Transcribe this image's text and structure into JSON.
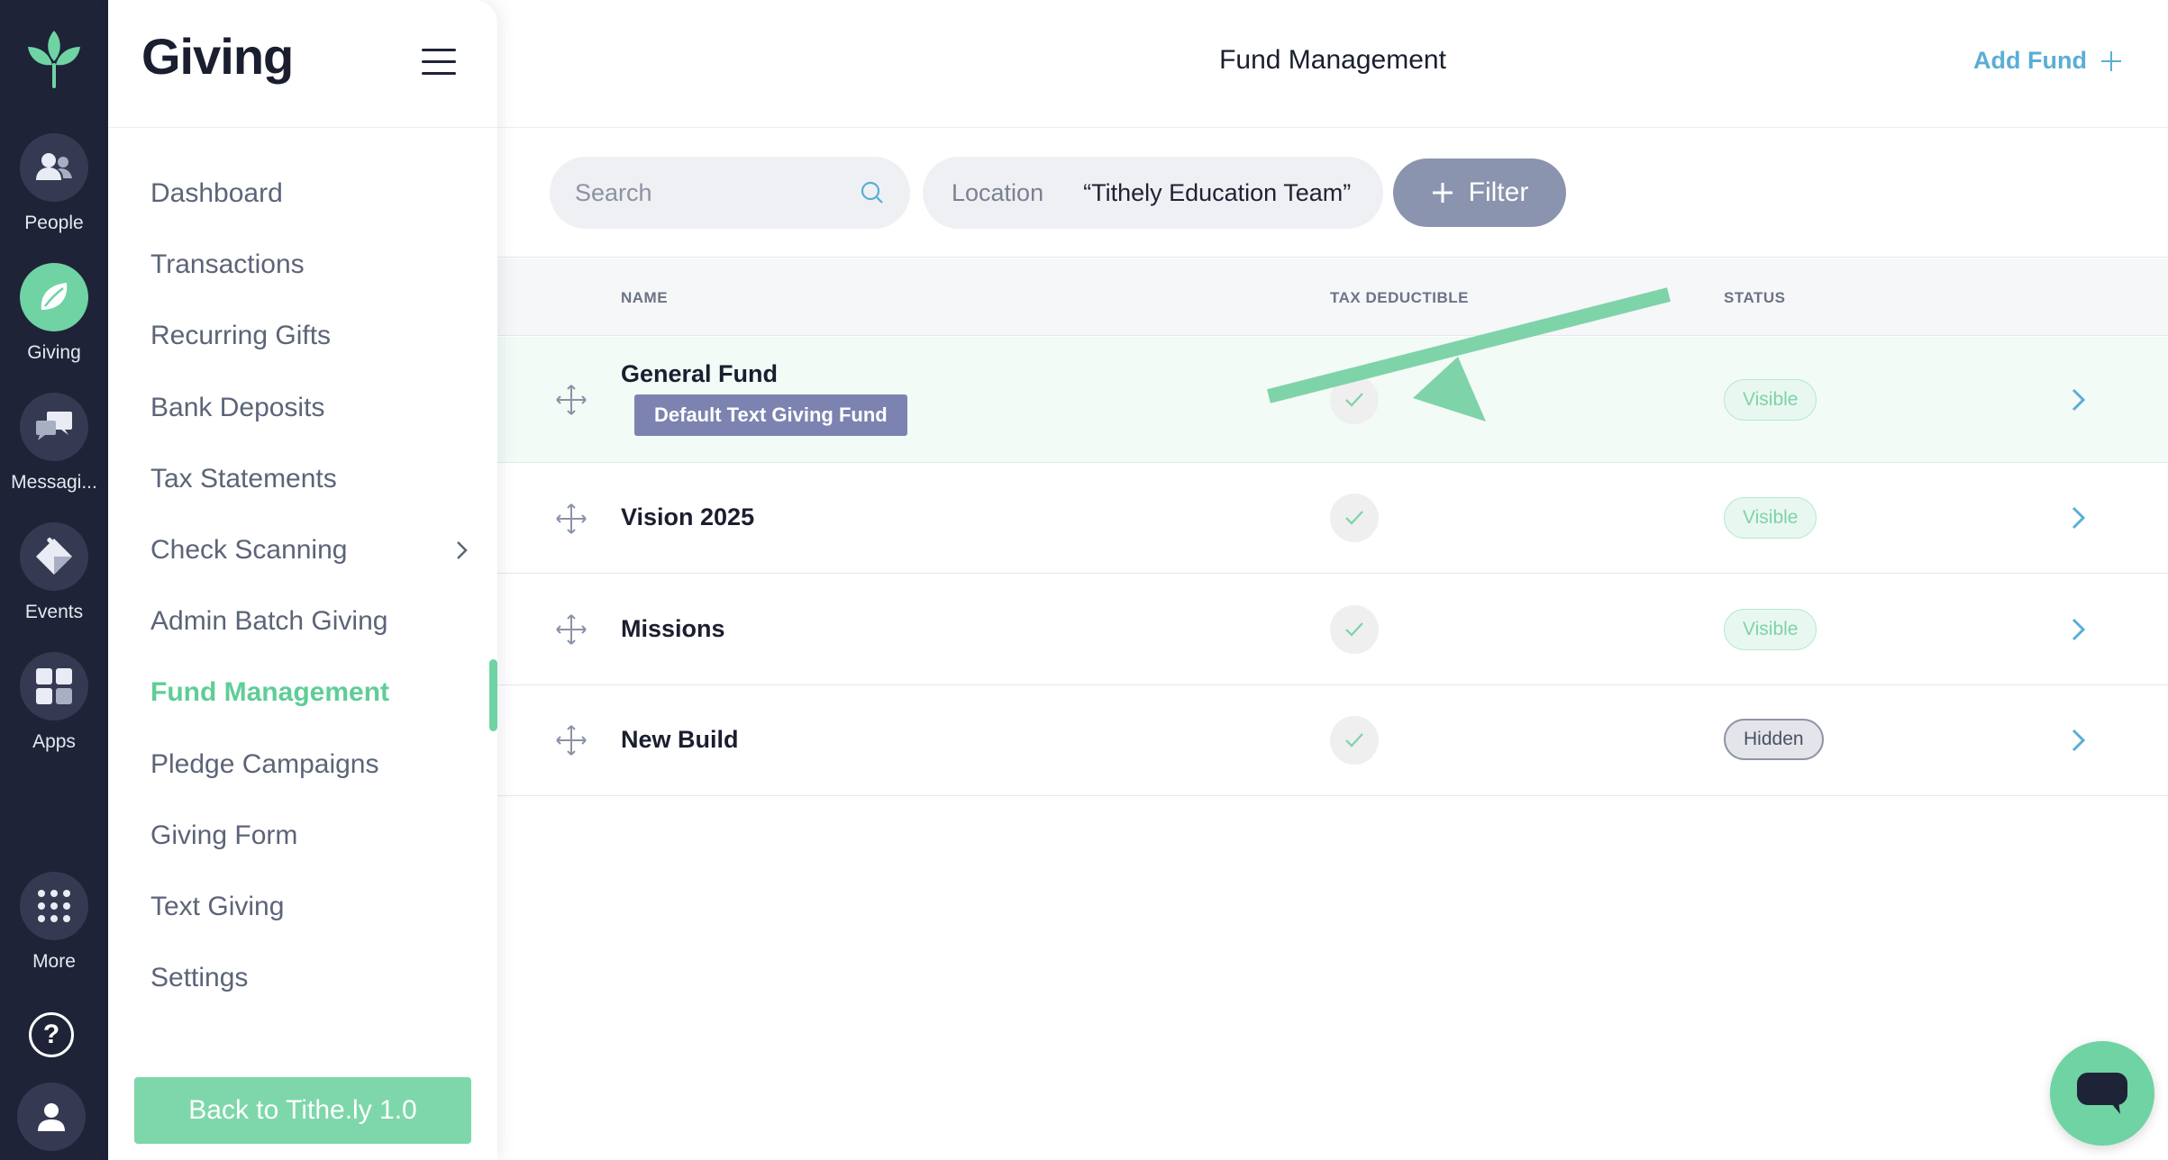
{
  "rail": {
    "items": [
      {
        "label": "People",
        "icon": "people-icon"
      },
      {
        "label": "Giving",
        "icon": "giving-leaf-icon",
        "active": true
      },
      {
        "label": "Messagi...",
        "icon": "messaging-icon"
      },
      {
        "label": "Events",
        "icon": "events-ticket-icon"
      },
      {
        "label": "Apps",
        "icon": "apps-grid-icon"
      },
      {
        "label": "More",
        "icon": "more-dots-icon"
      }
    ],
    "help_glyph": "?"
  },
  "nav": {
    "title": "Giving",
    "items": [
      {
        "label": "Dashboard"
      },
      {
        "label": "Transactions"
      },
      {
        "label": "Recurring Gifts"
      },
      {
        "label": "Bank Deposits"
      },
      {
        "label": "Tax Statements"
      },
      {
        "label": "Check Scanning",
        "has_submenu": true
      },
      {
        "label": "Admin Batch Giving"
      },
      {
        "label": "Fund Management",
        "active": true
      },
      {
        "label": "Pledge Campaigns"
      },
      {
        "label": "Giving Form"
      },
      {
        "label": "Text Giving"
      },
      {
        "label": "Settings"
      }
    ],
    "back_button": "Back to Tithe.ly 1.0"
  },
  "header": {
    "title": "Fund Management",
    "add_fund": "Add Fund"
  },
  "filters": {
    "search_placeholder": "Search",
    "location_label": "Location",
    "location_value": "“Tithely Education Team”",
    "filter_button": "Filter"
  },
  "table": {
    "columns": [
      "NAME",
      "TAX DEDUCTIBLE",
      "STATUS"
    ],
    "rows": [
      {
        "name": "General Fund",
        "badge": "Default Text Giving Fund",
        "tax_deductible": true,
        "status": "Visible"
      },
      {
        "name": "Vision 2025",
        "tax_deductible": true,
        "status": "Visible"
      },
      {
        "name": "Missions",
        "tax_deductible": true,
        "status": "Visible"
      },
      {
        "name": "New Build",
        "tax_deductible": true,
        "status": "Hidden"
      }
    ]
  },
  "colors": {
    "rail_bg": "#1f2337",
    "accent_green": "#6fd3a3",
    "link_blue": "#5aaed6",
    "filter_button": "#8a94ae",
    "default_badge": "#7d83b0"
  }
}
